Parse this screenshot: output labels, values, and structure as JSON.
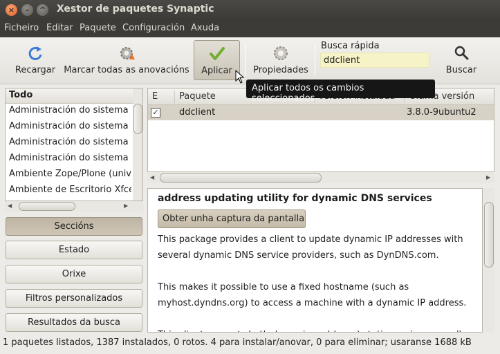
{
  "window": {
    "title": "Xestor de paquetes Synaptic"
  },
  "menubar": [
    "Ficheiro",
    "Editar",
    "Paquete",
    "Configuración",
    "Axuda"
  ],
  "toolbar": {
    "reload_label": "Recargar",
    "mark_upgrades_label": "Marcar todas as anovacións",
    "apply_label": "Aplicar",
    "properties_label": "Propiedades",
    "quick_search_label": "Busca rápida",
    "quick_search_value": "ddclient",
    "search_label": "Buscar"
  },
  "tooltip": "Aplicar todos os cambios seleccionados",
  "categories": {
    "header": "Todo",
    "items": [
      "Administración do sistema",
      "Administración do sistema",
      "Administración do sistema",
      "Administración do sistema",
      "Ambiente Zope/Plone (univ",
      "Ambiente de Escritorio Xfce"
    ]
  },
  "filter_buttons": [
    "Seccións",
    "Estado",
    "Orixe",
    "Filtros personalizados",
    "Resultados da busca"
  ],
  "package_table": {
    "columns": [
      "E",
      "Paquete",
      "Versión instalada",
      "Última versión"
    ],
    "rows": [
      {
        "name": "ddclient",
        "installed": "",
        "latest": "3.8.0-9ubuntu2",
        "checked": true
      }
    ]
  },
  "description": {
    "title": "address updating utility for dynamic DNS services",
    "screenshot_button": "Obter unha captura da pantalla",
    "para1_line1": "This package provides a client to update dynamic IP addresses with",
    "para1_line2": "several dynamic DNS service providers, such as DynDNS.com.",
    "para2_line1": "This makes it possible to use a fixed hostname (such as",
    "para2_line2": "myhost.dyndns.org) to access a machine with a dynamic IP address.",
    "para3_partial": "This client supports both dynamic and (near) static services as well"
  },
  "status": "1 paquetes listados, 1387 instalados, 0 rotos. 4 para instalar/anovar, 0 para eliminar; usaranse 1688 kB"
}
